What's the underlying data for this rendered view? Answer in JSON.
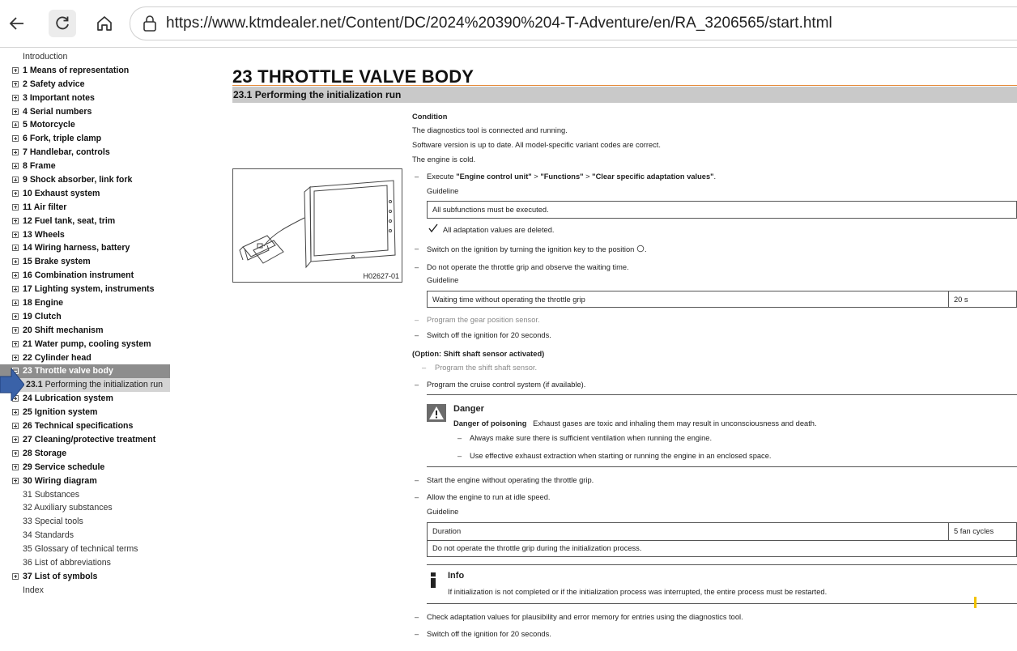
{
  "browser": {
    "url": "https://www.ktmdealer.net/Content/DC/2024%20390%204-T-Adventure/en/RA_3206565/start.html"
  },
  "toc": [
    {
      "label": "Introduction",
      "type": "plain"
    },
    {
      "label": "1 Means of representation",
      "type": "plus"
    },
    {
      "label": "2 Safety advice",
      "type": "plus"
    },
    {
      "label": "3 Important notes",
      "type": "plus"
    },
    {
      "label": "4 Serial numbers",
      "type": "plus"
    },
    {
      "label": "5 Motorcycle",
      "type": "plus"
    },
    {
      "label": "6 Fork, triple clamp",
      "type": "plus"
    },
    {
      "label": "7 Handlebar, controls",
      "type": "plus"
    },
    {
      "label": "8 Frame",
      "type": "plus"
    },
    {
      "label": "9 Shock absorber, link fork",
      "type": "plus"
    },
    {
      "label": "10 Exhaust system",
      "type": "plus"
    },
    {
      "label": "11 Air filter",
      "type": "plus"
    },
    {
      "label": "12 Fuel tank, seat, trim",
      "type": "plus"
    },
    {
      "label": "13 Wheels",
      "type": "plus"
    },
    {
      "label": "14 Wiring harness, battery",
      "type": "plus"
    },
    {
      "label": "15 Brake system",
      "type": "plus"
    },
    {
      "label": "16 Combination instrument",
      "type": "plus"
    },
    {
      "label": "17 Lighting system, instruments",
      "type": "plus"
    },
    {
      "label": "18 Engine",
      "type": "plus"
    },
    {
      "label": "19 Clutch",
      "type": "plus"
    },
    {
      "label": "20 Shift mechanism",
      "type": "plus"
    },
    {
      "label": "21 Water pump, cooling system",
      "type": "plus"
    },
    {
      "label": "22 Cylinder head",
      "type": "plus"
    },
    {
      "label": "23 Throttle valve body",
      "type": "active"
    },
    {
      "label": "23.1 Performing the initialization run",
      "type": "sub",
      "num": "23.1",
      "text": " Performing the initialization run"
    },
    {
      "label": "24 Lubrication system",
      "type": "plus"
    },
    {
      "label": "25 Ignition system",
      "type": "plus"
    },
    {
      "label": "26 Technical specifications",
      "type": "plus"
    },
    {
      "label": "27 Cleaning/protective treatment",
      "type": "plus"
    },
    {
      "label": "28 Storage",
      "type": "plus"
    },
    {
      "label": "29 Service schedule",
      "type": "plus"
    },
    {
      "label": "30 Wiring diagram",
      "type": "plus"
    },
    {
      "label": "31 Substances",
      "type": "plain"
    },
    {
      "label": "32 Auxiliary substances",
      "type": "plain"
    },
    {
      "label": "33 Special tools",
      "type": "plain"
    },
    {
      "label": "34 Standards",
      "type": "plain"
    },
    {
      "label": "35 Glossary of technical terms",
      "type": "plain"
    },
    {
      "label": "36 List of abbreviations",
      "type": "plain"
    },
    {
      "label": "37 List of symbols",
      "type": "plus"
    },
    {
      "label": "Index",
      "type": "plain"
    }
  ],
  "main": {
    "title": "23 THROTTLE VALVE BODY",
    "section": "23.1 Performing the initialization run",
    "figure_code": "H02627-01",
    "condition_label": "Condition",
    "conditions": [
      "The diagnostics tool is connected and running.",
      "Software version is up to date. All model-specific variant codes are correct.",
      "The engine is cold."
    ],
    "step1": {
      "prefix": "Execute ",
      "q1": "\"Engine control unit\"",
      "sep1": " > ",
      "q2": "\"Functions\"",
      "sep2": " > ",
      "q3": "\"Clear specific adaptation values\"",
      "end": "."
    },
    "guideline_label": "Guideline",
    "guideline1": "All subfunctions must be executed.",
    "result1": "All adaptation values are deleted.",
    "step2": "Switch on the ignition by turning the ignition key to the position",
    "step3": "Do not operate the throttle grip and observe the waiting time.",
    "guideline2": {
      "label": "Waiting time without operating the throttle grip",
      "value": "20 s"
    },
    "step4": "Program the gear position sensor.",
    "step5": "Switch off the ignition for 20 seconds.",
    "option_label": "(Option: Shift shaft sensor activated)",
    "option_step": "Program the shift shaft sensor.",
    "step6": "Program the cruise control system (if available).",
    "danger": {
      "title": "Danger",
      "lead": "Danger of poisoning",
      "text": "Exhaust gases are toxic and inhaling them may result in unconsciousness and death.",
      "items": [
        "Always make sure there is sufficient ventilation when running the engine.",
        "Use effective exhaust extraction when starting or running the engine in an enclosed space."
      ]
    },
    "step7": "Start the engine without operating the throttle grip.",
    "step8": "Allow the engine to run at idle speed.",
    "guideline3": {
      "label": "Duration",
      "value": "5 fan cycles",
      "note": "Do not operate the throttle grip during the initialization process."
    },
    "info": {
      "title": "Info",
      "text": "If initialization is not completed or if the initialization process was interrupted, the entire process must be restarted."
    },
    "step9": "Check adaptation values for plausibility and error memory for entries using the diagnostics tool.",
    "step10": "Switch off the ignition for 20 seconds."
  }
}
